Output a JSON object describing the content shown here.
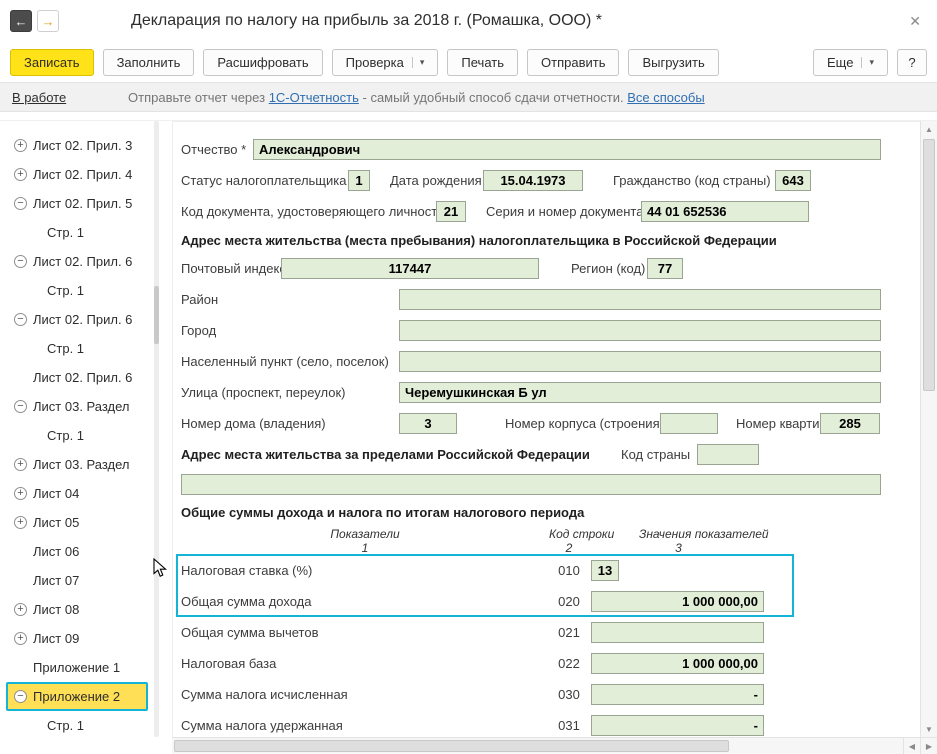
{
  "window": {
    "title": "Декларация по налогу на прибыль за 2018 г. (Ромашка, ООО) *"
  },
  "icons": {
    "back": "←",
    "forward": "→",
    "close": "✕",
    "caret": "▾",
    "up": "▲",
    "down": "▼",
    "left": "◀",
    "right": "▶"
  },
  "toolbar": {
    "save": "Записать",
    "fill": "Заполнить",
    "decipher": "Расшифровать",
    "check": "Проверка",
    "print": "Печать",
    "send": "Отправить",
    "export": "Выгрузить",
    "more": "Еще",
    "help": "?"
  },
  "status": {
    "state": "В работе",
    "before": "Отправьте отчет через",
    "service_link": "1С-Отчетность",
    "after": "- самый удобный способ сдачи отчетности.",
    "all_link": "Все способы"
  },
  "sidebar": {
    "items": [
      {
        "label": "Лист 02. Прил. 3",
        "glyph": "+"
      },
      {
        "label": "Лист 02. Прил. 4",
        "glyph": "+"
      },
      {
        "label": "Лист 02. Прил. 5",
        "glyph": "−"
      },
      {
        "label": "Стр. 1",
        "glyph": ""
      },
      {
        "label": "Лист 02. Прил. 6",
        "glyph": "−"
      },
      {
        "label": "Стр. 1",
        "glyph": ""
      },
      {
        "label": "Лист 02. Прил. 6",
        "glyph": "−"
      },
      {
        "label": "Стр. 1",
        "glyph": ""
      },
      {
        "label": "Лист 02. Прил. 6",
        "glyph": ""
      },
      {
        "label": "Лист 03. Раздел",
        "glyph": "−"
      },
      {
        "label": "Стр. 1",
        "glyph": ""
      },
      {
        "label": "Лист 03. Раздел",
        "glyph": "+"
      },
      {
        "label": "Лист 04",
        "glyph": "+"
      },
      {
        "label": "Лист 05",
        "glyph": "+"
      },
      {
        "label": "Лист 06",
        "glyph": ""
      },
      {
        "label": "Лист 07",
        "glyph": ""
      },
      {
        "label": "Лист 08",
        "glyph": "+"
      },
      {
        "label": "Лист 09",
        "glyph": "+"
      },
      {
        "label": "Приложение 1",
        "glyph": ""
      },
      {
        "label": "Приложение 2",
        "glyph": "−"
      },
      {
        "label": "Стр. 1",
        "glyph": ""
      }
    ]
  },
  "form": {
    "middle_name": {
      "label": "Отчество *",
      "value": "Александрович"
    },
    "taxpayer_status": {
      "label": "Статус налогоплательщика",
      "value": "1"
    },
    "birth_date": {
      "label": "Дата рождения",
      "value": "15.04.1973"
    },
    "citizenship": {
      "label": "Гражданство (код страны)",
      "value": "643"
    },
    "doc_code": {
      "label": "Код документа, удостоверяющего личность",
      "value": "21"
    },
    "doc_series": {
      "label": "Серия и номер документа",
      "value": "44 01 652536"
    },
    "address_ru_header": "Адрес места жительства (места пребывания) налогоплательщика в Российской Федерации",
    "postal_code": {
      "label": "Почтовый индекс",
      "value": "117447"
    },
    "region": {
      "label": "Регион (код)",
      "value": "77"
    },
    "district": {
      "label": "Район",
      "value": ""
    },
    "city": {
      "label": "Город",
      "value": ""
    },
    "settlement": {
      "label": "Населенный пункт (село, поселок)",
      "value": ""
    },
    "street": {
      "label": "Улица (проспект, переулок)",
      "value": "Черемушкинская Б ул"
    },
    "house": {
      "label": "Номер дома (владения)",
      "value": "3"
    },
    "building": {
      "label": "Номер корпуса (строения)",
      "value": ""
    },
    "apartment": {
      "label": "Номер квартиры",
      "value": "285"
    },
    "foreign_header": "Адрес места жительства за пределами Российской Федерации",
    "country_code": {
      "label": "Код страны",
      "value": ""
    },
    "foreign_address": {
      "value": ""
    },
    "totals_header": "Общие суммы дохода и налога по итогам налогового периода"
  },
  "table": {
    "col1": {
      "title": "Показатели",
      "num": "1"
    },
    "col2": {
      "title": "Код строки",
      "num": "2"
    },
    "col3": {
      "title": "Значения показателей",
      "num": "3"
    },
    "rows": [
      {
        "label": "Налоговая ставка (%)",
        "code": "010",
        "value": "13"
      },
      {
        "label": "Общая сумма дохода",
        "code": "020",
        "value": "1 000 000,00"
      },
      {
        "label": "Общая сумма вычетов",
        "code": "021",
        "value": ""
      },
      {
        "label": "Налоговая база",
        "code": "022",
        "value": "1 000 000,00"
      },
      {
        "label": "Сумма налога исчисленная",
        "code": "030",
        "value": "-"
      },
      {
        "label": "Сумма налога удержанная",
        "code": "031",
        "value": "-"
      }
    ]
  },
  "colors": {
    "accent_teal": "#14b4d6",
    "button_yellow": "#ffe217",
    "selected_yellow": "#ffdf55",
    "field_green": "#e3eed8",
    "link_blue": "#2f6fb2"
  }
}
